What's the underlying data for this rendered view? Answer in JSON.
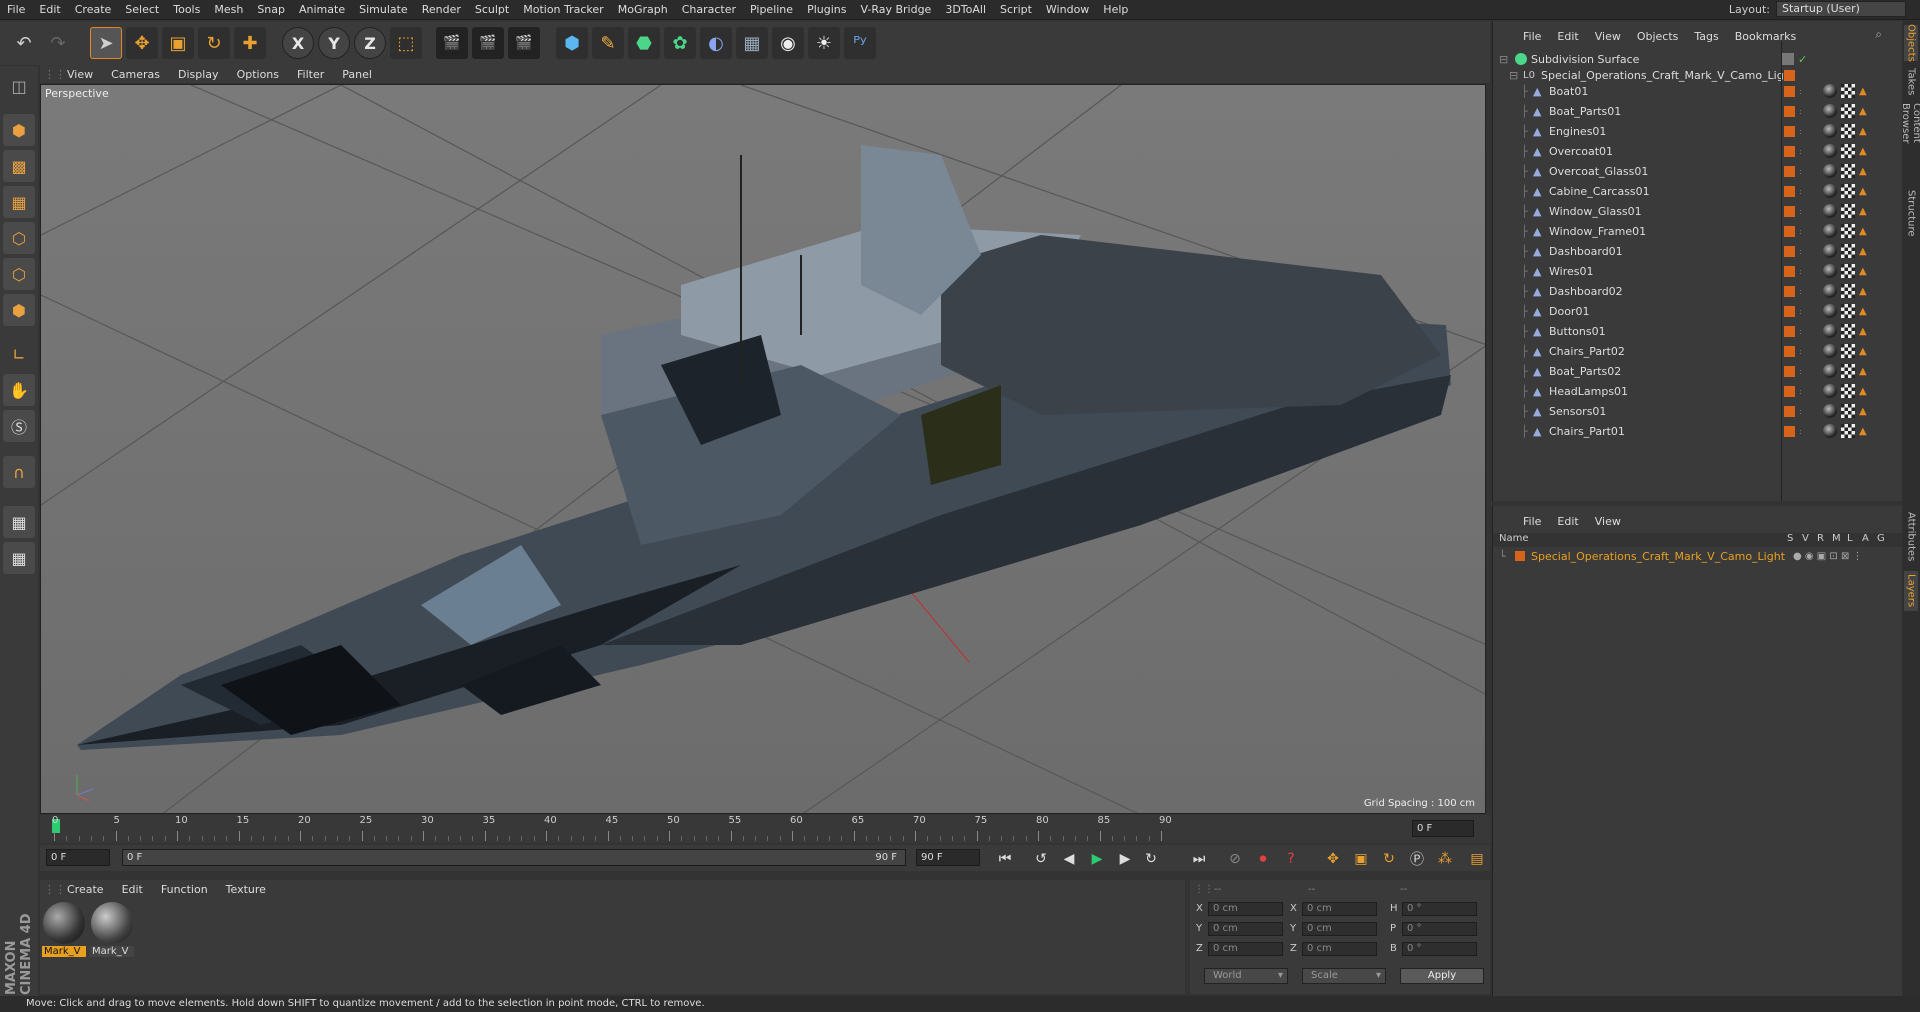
{
  "menubar": {
    "items": [
      "File",
      "Edit",
      "Create",
      "Select",
      "Tools",
      "Mesh",
      "Snap",
      "Animate",
      "Simulate",
      "Render",
      "Sculpt",
      "Motion Tracker",
      "MoGraph",
      "Character",
      "Pipeline",
      "Plugins",
      "V-Ray Bridge",
      "3DToAll",
      "Script",
      "Window",
      "Help"
    ],
    "layout_label": "Layout:",
    "layout_value": "Startup (User)"
  },
  "toolbar": {
    "icons": [
      "undo-icon",
      "redo-icon",
      "select-arrow-icon",
      "move-icon",
      "scale-icon",
      "rotate-icon",
      "add-icon",
      "x-axis-icon",
      "y-axis-icon",
      "z-axis-icon",
      "coordinate-system-icon",
      "render-view-icon",
      "render-picture-queue-icon",
      "render-settings-icon",
      "cube-icon",
      "pen-icon",
      "generator-icon",
      "array-icon",
      "deformer-icon",
      "floor-icon",
      "camera-icon",
      "light-icon",
      "python-icon"
    ],
    "x_label": "X",
    "y_label": "Y",
    "z_label": "Z"
  },
  "left_toolbar": {
    "icons": [
      "make-editable-icon",
      "model-mode-icon",
      "texture-mode-icon",
      "workplane-icon",
      "points-mode-icon",
      "edges-mode-icon",
      "polygons-mode-icon",
      "axis-icon",
      "tweak-icon",
      "snap-icon",
      "magnet-icon",
      "grid-lock-icon",
      "soft-selection-icon"
    ]
  },
  "viewport": {
    "menu": [
      "View",
      "Cameras",
      "Display",
      "Options",
      "Filter",
      "Panel"
    ],
    "label": "Perspective",
    "grid_spacing": "Grid Spacing : 100 cm"
  },
  "timeline": {
    "ticks": [
      "0",
      "5",
      "10",
      "15",
      "20",
      "25",
      "30",
      "35",
      "40",
      "45",
      "50",
      "55",
      "60",
      "65",
      "70",
      "75",
      "80",
      "85",
      "90"
    ],
    "current_frame_right": "0 F",
    "start_field": "0 F",
    "range_start": "0 F",
    "range_end": "90 F",
    "end_field": "90 F"
  },
  "materials": {
    "menu": [
      "Create",
      "Edit",
      "Function",
      "Texture"
    ],
    "items": [
      {
        "label": "Mark_V",
        "selected": true
      },
      {
        "label": "Mark_V",
        "selected": false
      }
    ]
  },
  "coordinates": {
    "headers": [
      "--",
      "--",
      "--"
    ],
    "rows": [
      {
        "a": "X",
        "av": "0 cm",
        "b": "X",
        "bv": "0 cm",
        "c": "H",
        "cv": "0 °"
      },
      {
        "a": "Y",
        "av": "0 cm",
        "b": "Y",
        "bv": "0 cm",
        "c": "P",
        "cv": "0 °"
      },
      {
        "a": "Z",
        "av": "0 cm",
        "b": "Z",
        "bv": "0 cm",
        "c": "B",
        "cv": "0 °"
      }
    ],
    "world": "World",
    "scale": "Scale",
    "apply": "Apply"
  },
  "status": "Move: Click and drag to move elements. Hold down SHIFT to quantize movement / add to the selection in point mode, CTRL to remove.",
  "object_manager": {
    "menu": [
      "File",
      "Edit",
      "View",
      "Objects",
      "Tags",
      "Bookmarks"
    ],
    "subdivision": "Subdivision Surface",
    "root": "Special_Operations_Craft_Mark_V_Camo_Light",
    "children": [
      "Boat01",
      "Boat_Parts01",
      "Engines01",
      "Overcoat01",
      "Overcoat_Glass01",
      "Cabine_Carcass01",
      "Window_Glass01",
      "Window_Frame01",
      "Dashboard01",
      "Wires01",
      "Dashboard02",
      "Door01",
      "Buttons01",
      "Chairs_Part02",
      "Boat_Parts02",
      "HeadLamps01",
      "Sensors01",
      "Chairs_Part01"
    ]
  },
  "layer_manager": {
    "menu": [
      "File",
      "Edit",
      "View"
    ],
    "name_header": "Name",
    "cols": [
      "S",
      "V",
      "R",
      "M",
      "L",
      "A",
      "G"
    ],
    "layer": "Special_Operations_Craft_Mark_V_Camo_Light",
    "layer_color": "#d8641c"
  },
  "right_tabs": [
    "Objects",
    "Takes",
    "Content Browser",
    "Structure",
    "Attributes",
    "Layers"
  ],
  "colors": {
    "accent": "#e28a22",
    "layer_text": "#e8a020"
  }
}
